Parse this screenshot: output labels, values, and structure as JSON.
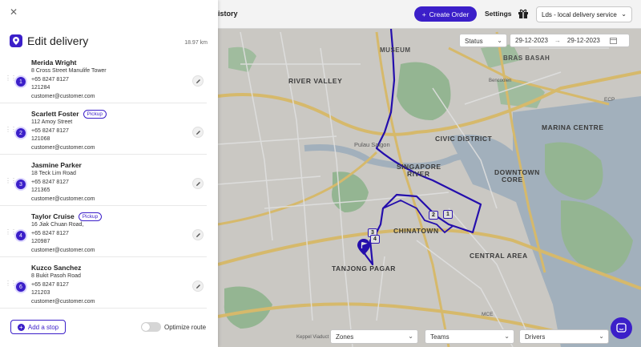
{
  "topbar": {
    "history_fragment": "istory",
    "create_order": "Create Order",
    "settings": "Settings",
    "store_select": "Lds - local delivery service"
  },
  "filters": {
    "status": "Status",
    "date_from": "29-12-2023",
    "date_arrow": "→",
    "date_to": "29-12-2023",
    "zones": "Zones",
    "teams": "Teams",
    "drivers": "Drivers"
  },
  "map": {
    "labels": {
      "museum": "MUSEUM",
      "bras_basah": "BRAS BASAH",
      "river_valley": "RIVER VALLEY",
      "marina_centre": "MARINA CENTRE",
      "civic_district": "CIVIC DISTRICT",
      "pulau_saigon": "Pulau Saigon",
      "singapore_river_1": "SINGAPORE",
      "singapore_river_2": "RIVER",
      "downtown_1": "DOWNTOWN",
      "downtown_2": "CORE",
      "chinatown": "CHINATOWN",
      "tanjong_pagar": "TANJONG PAGAR",
      "central_area": "CENTRAL AREA",
      "bencoolen": "Bencoolen",
      "ecp": "ECP",
      "mce": "MCE",
      "keppel_viaduct": "Keppel Viaduct"
    },
    "markers": [
      "1",
      "2",
      "3",
      "4"
    ],
    "accent": "#3b1fc9"
  },
  "panel": {
    "title": "Edit delivery",
    "distance": "18.97 km",
    "add_stop": "Add a stop",
    "optimize_route": "Optimize route",
    "stops": [
      {
        "num": "1",
        "name": "Merida Wright",
        "pickup": "",
        "address": "8 Cross Street Manulife Tower",
        "phone": "+65 8247 8127",
        "postal": "121284",
        "email": "customer@customer.com"
      },
      {
        "num": "2",
        "name": "Scarlett Foster",
        "pickup": "Pickup",
        "address": "112 Amoy Street",
        "phone": "+65 8247 8127",
        "postal": "121068",
        "email": "customer@customer.com"
      },
      {
        "num": "3",
        "name": "Jasmine Parker",
        "pickup": "",
        "address": "18 Teck Lim Road",
        "phone": "+65 8247 8127",
        "postal": "121365",
        "email": "customer@customer.com"
      },
      {
        "num": "4",
        "name": "Taylor Cruise",
        "pickup": "Pickup",
        "address": "16 Jiak Chuan Road,",
        "phone": "+65 8247 8127",
        "postal": "120987",
        "email": "customer@customer.com"
      },
      {
        "num": "6",
        "name": "Kuzco Sanchez",
        "pickup": "",
        "address": "8 Bukit Pasoh Road",
        "phone": "+65 8247 8127",
        "postal": "121203",
        "email": "customer@customer.com"
      }
    ]
  }
}
